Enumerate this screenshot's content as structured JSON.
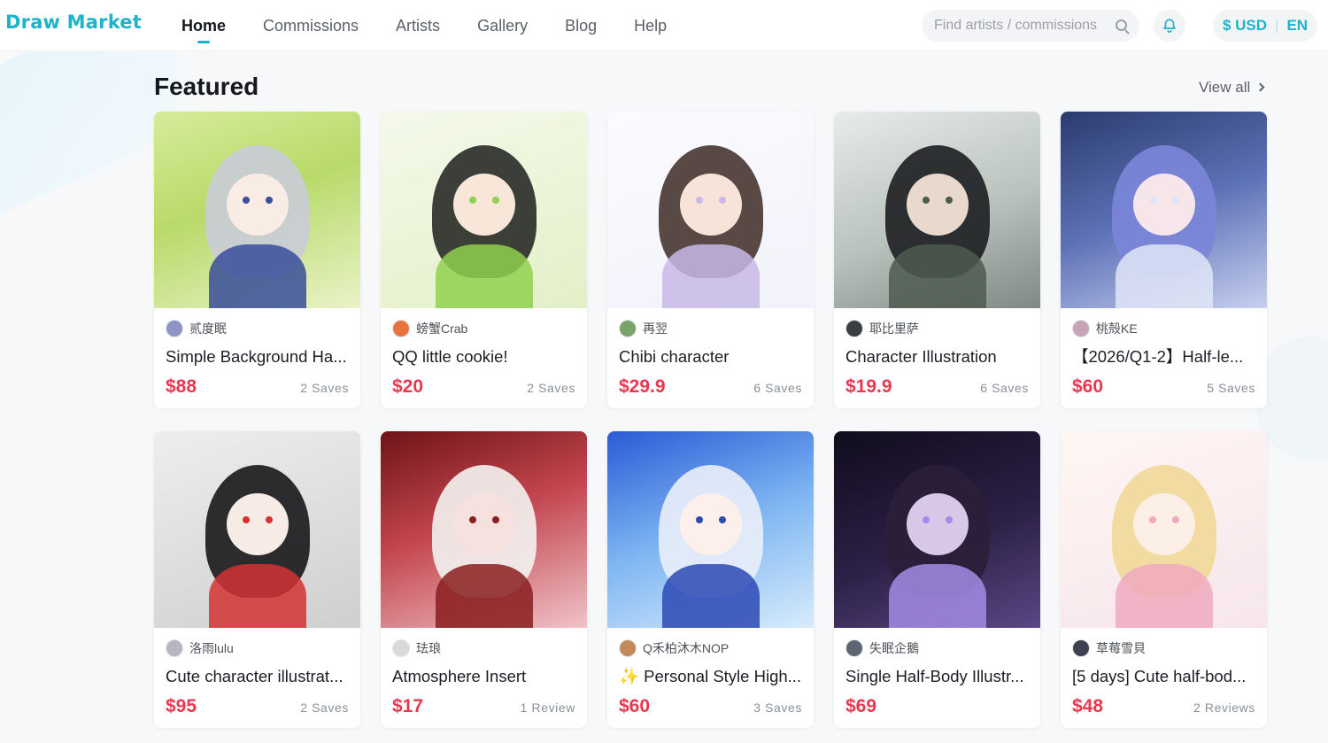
{
  "brand": {
    "logo_text": "Draw Market"
  },
  "nav": {
    "items": [
      {
        "label": "Home",
        "active": true
      },
      {
        "label": "Commissions",
        "active": false
      },
      {
        "label": "Artists",
        "active": false
      },
      {
        "label": "Gallery",
        "active": false
      },
      {
        "label": "Blog",
        "active": false
      },
      {
        "label": "Help",
        "active": false
      }
    ]
  },
  "search": {
    "placeholder": "Find artists / commissions",
    "value": ""
  },
  "header_right": {
    "currency": "$ USD",
    "language": "EN",
    "bell_icon": "bell-icon"
  },
  "featured": {
    "title": "Featured",
    "view_all": "View all",
    "cards": [
      {
        "artist": "贰度眠",
        "title": "Simple Background Ha...",
        "price": "$88",
        "meta": "2 Saves"
      },
      {
        "artist": "螃蟹Crab",
        "title": "QQ little cookie!",
        "price": "$20",
        "meta": "2 Saves"
      },
      {
        "artist": "再翌",
        "title": "Chibi character",
        "price": "$29.9",
        "meta": "6 Saves"
      },
      {
        "artist": "耶比里萨",
        "title": "Character Illustration",
        "price": "$19.9",
        "meta": "6 Saves"
      },
      {
        "artist": "桃殻KE",
        "title": "【2026/Q1-2】Half-le...",
        "price": "$60",
        "meta": "5 Saves"
      },
      {
        "artist": "洛雨lulu",
        "title": "Cute character illustrat...",
        "price": "$95",
        "meta": "2 Saves"
      },
      {
        "artist": "珐琅",
        "title": "Atmosphere Insert",
        "price": "$17",
        "meta": "1 Review"
      },
      {
        "artist": "Q禾柏沐木NOP",
        "title": "✨ Personal Style High...",
        "price": "$60",
        "meta": "3 Saves"
      },
      {
        "artist": "失眠企鵝",
        "title": "Single Half-Body Illustr...",
        "price": "$69",
        "meta": ""
      },
      {
        "artist": "草莓雪貝",
        "title": "[5 days] Cute half-bod...",
        "price": "$48",
        "meta": "2 Reviews"
      }
    ]
  },
  "colors": {
    "accent": "#1fb3c9",
    "price": "#e8384f",
    "background": "#f7f8fa"
  }
}
